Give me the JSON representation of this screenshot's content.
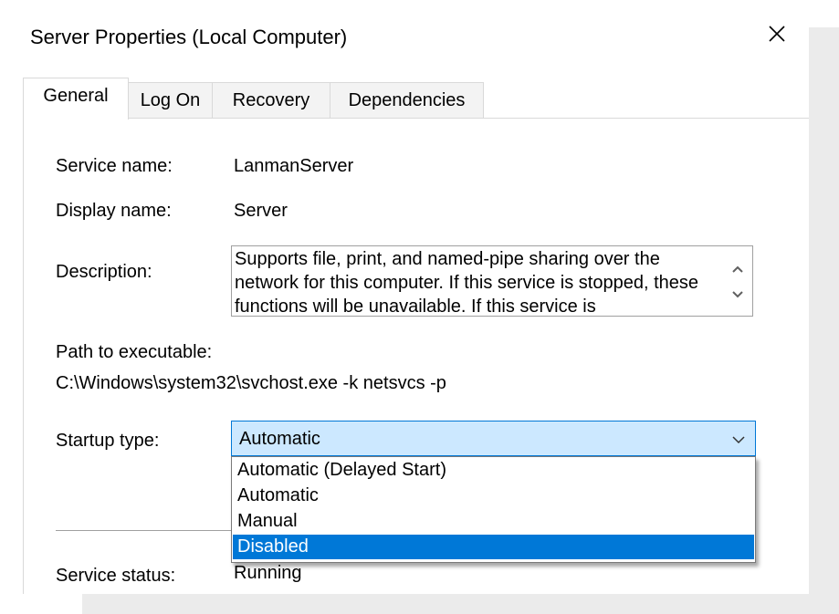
{
  "window": {
    "title": "Server Properties (Local Computer)",
    "close_icon": "close-icon"
  },
  "tabs": [
    {
      "label": "General",
      "active": true
    },
    {
      "label": "Log On",
      "active": false
    },
    {
      "label": "Recovery",
      "active": false
    },
    {
      "label": "Dependencies",
      "active": false
    }
  ],
  "general": {
    "service_name_label": "Service name:",
    "service_name_value": "LanmanServer",
    "display_name_label": "Display name:",
    "display_name_value": "Server",
    "description_label": "Description:",
    "description_value": "Supports file, print, and named-pipe sharing over the network for this computer. If this service is stopped, these functions will be unavailable. If this service is",
    "path_label": "Path to executable:",
    "path_value": "C:\\Windows\\system32\\svchost.exe -k netsvcs -p",
    "startup_type_label": "Startup type:",
    "startup_type_value": "Automatic",
    "startup_options": [
      "Automatic (Delayed Start)",
      "Automatic",
      "Manual",
      "Disabled"
    ],
    "highlighted_option": "Disabled",
    "service_status_label": "Service status:",
    "service_status_value": "Running"
  },
  "colors": {
    "accent": "#0078d7",
    "combo_background": "#cce8ff"
  }
}
